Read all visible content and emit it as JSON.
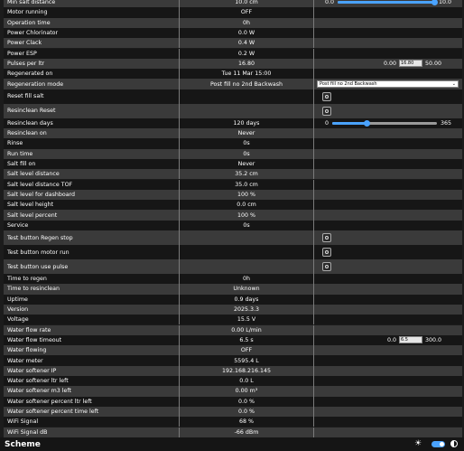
{
  "rows": [
    {
      "label": "Min salt distance",
      "value": "10.0 cm",
      "control": {
        "type": "slider",
        "min": "0.0",
        "max": "10.0",
        "fraction": 1.0
      }
    },
    {
      "label": "Motor running",
      "value": "OFF"
    },
    {
      "label": "Operation time",
      "value": "0h"
    },
    {
      "label": "Power Chlorinator",
      "value": "0.0 W"
    },
    {
      "label": "Power Clack",
      "value": "0.4 W"
    },
    {
      "label": "Power ESP",
      "value": "0.2 W"
    },
    {
      "label": "Pulses per ltr",
      "value": "16.80",
      "control": {
        "type": "number",
        "min": "0.00",
        "input": "16.80",
        "max": "50.00"
      }
    },
    {
      "label": "Regenerated on",
      "value": "Tue 11 Mar 15:00"
    },
    {
      "label": "Regeneration mode",
      "value": "Post fill no 2nd Backwash",
      "control": {
        "type": "select",
        "selected": "Post fill no 2nd Backwash"
      }
    },
    {
      "label": "Reset fill salt",
      "value": "",
      "control": {
        "type": "button"
      }
    },
    {
      "label": "Resinclean Reset",
      "value": "",
      "control": {
        "type": "button"
      }
    },
    {
      "label": "Resinclean days",
      "value": "120 days",
      "control": {
        "type": "slider",
        "min": "0",
        "max": "365",
        "fraction": 0.329
      }
    },
    {
      "label": "Resinclean on",
      "value": "Never"
    },
    {
      "label": "Rinse",
      "value": "0s"
    },
    {
      "label": "Run time",
      "value": "0s"
    },
    {
      "label": "Salt fill on",
      "value": "Never"
    },
    {
      "label": "Salt level distance",
      "value": "35.2 cm"
    },
    {
      "label": "Salt level distance TOF",
      "value": "35.0 cm"
    },
    {
      "label": "Salt level for dashboard",
      "value": "100 %"
    },
    {
      "label": "Salt level height",
      "value": "0.0 cm"
    },
    {
      "label": "Salt level percent",
      "value": "100 %"
    },
    {
      "label": "Service",
      "value": "0s"
    },
    {
      "label": "Test button Regen stop",
      "value": "",
      "control": {
        "type": "button"
      }
    },
    {
      "label": "Test button motor run",
      "value": "",
      "control": {
        "type": "button"
      }
    },
    {
      "label": "Test button use pulse",
      "value": "",
      "control": {
        "type": "button"
      }
    },
    {
      "label": "Time to regen",
      "value": "0h"
    },
    {
      "label": "Time to resinclean",
      "value": "Unknown"
    },
    {
      "label": "Uptime",
      "value": "0.9 days"
    },
    {
      "label": "Version",
      "value": "2025.3.3"
    },
    {
      "label": "Voltage",
      "value": "15.5 V"
    },
    {
      "label": "Water flow rate",
      "value": "0.00 L/min"
    },
    {
      "label": "Water flow timeout",
      "value": "6.5 s",
      "control": {
        "type": "number",
        "min": "0.0",
        "input": "6.5",
        "max": "300.0"
      }
    },
    {
      "label": "Water flowing",
      "value": "OFF"
    },
    {
      "label": "Water meter",
      "value": "5595.4 L"
    },
    {
      "label": "Water softener IP",
      "value": "192.168.216.145"
    },
    {
      "label": "Water softener ltr left",
      "value": "0.0 L"
    },
    {
      "label": "Water softener m3 left",
      "value": "0.00 m³"
    },
    {
      "label": "Water softener percent ltr left",
      "value": "0.0 %"
    },
    {
      "label": "Water softener percent time left",
      "value": "0.0 %"
    },
    {
      "label": "WiFi Signal",
      "value": "68 %"
    },
    {
      "label": "WiFi Signal dB",
      "value": "-66 dBm"
    }
  ],
  "footer": {
    "title": "Scheme",
    "dark_mode_enabled": true
  },
  "colors": {
    "accent": "#4aa3ff",
    "row_light": "#3a3a3a",
    "row_dark": "#161616",
    "background": "#1c1c1c"
  }
}
